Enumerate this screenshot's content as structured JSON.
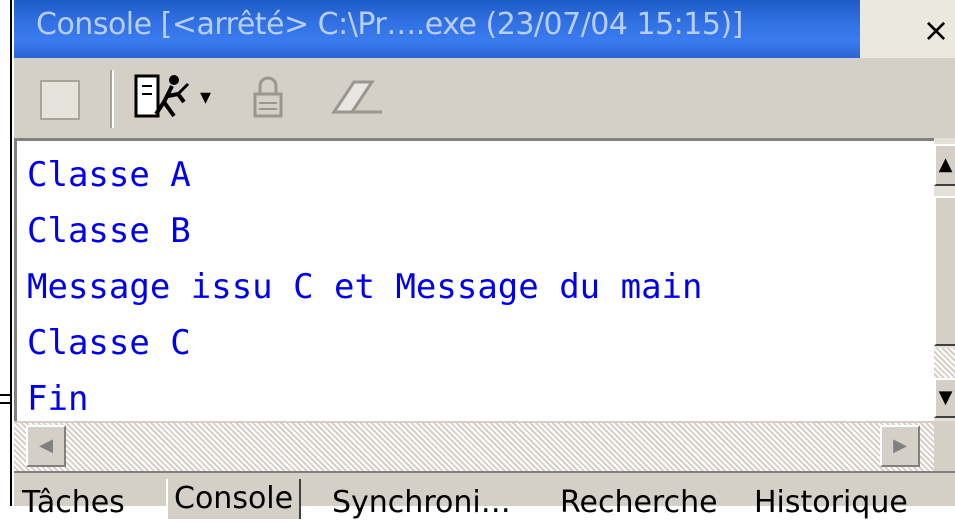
{
  "window": {
    "title": "Console [<arrêté> C:\\Pr….exe (23/07/04 15:15)]",
    "close_glyph": "×"
  },
  "toolbar": {
    "buttons": [
      {
        "name": "terminate",
        "icon": "stop-icon"
      },
      {
        "name": "run",
        "icon": "run-icon"
      },
      {
        "name": "run-dropdown",
        "icon": "chevron-down-icon",
        "glyph": "▾"
      },
      {
        "name": "pin",
        "icon": "lock-icon"
      },
      {
        "name": "clear",
        "icon": "eraser-icon"
      }
    ]
  },
  "console": {
    "lines": [
      "Classe A",
      "Classe B",
      "Message issu C et Message du main",
      "Classe C",
      "Fin"
    ],
    "text_color": "#0000ee"
  },
  "scrollbars": {
    "up_glyph": "▲",
    "down_glyph": "▼",
    "left_glyph": "◀",
    "right_glyph": "▶"
  },
  "tabs": [
    {
      "label": "Tâches",
      "active": false
    },
    {
      "label": "Console",
      "active": true
    },
    {
      "label": "Synchroni…",
      "active": false
    },
    {
      "label": "Recherche",
      "active": false
    },
    {
      "label": "Historique",
      "active": false
    }
  ],
  "colors": {
    "title_bar": "#2f6fe0",
    "title_text": "#b8cdf7",
    "chrome": "#d4d0c8"
  }
}
